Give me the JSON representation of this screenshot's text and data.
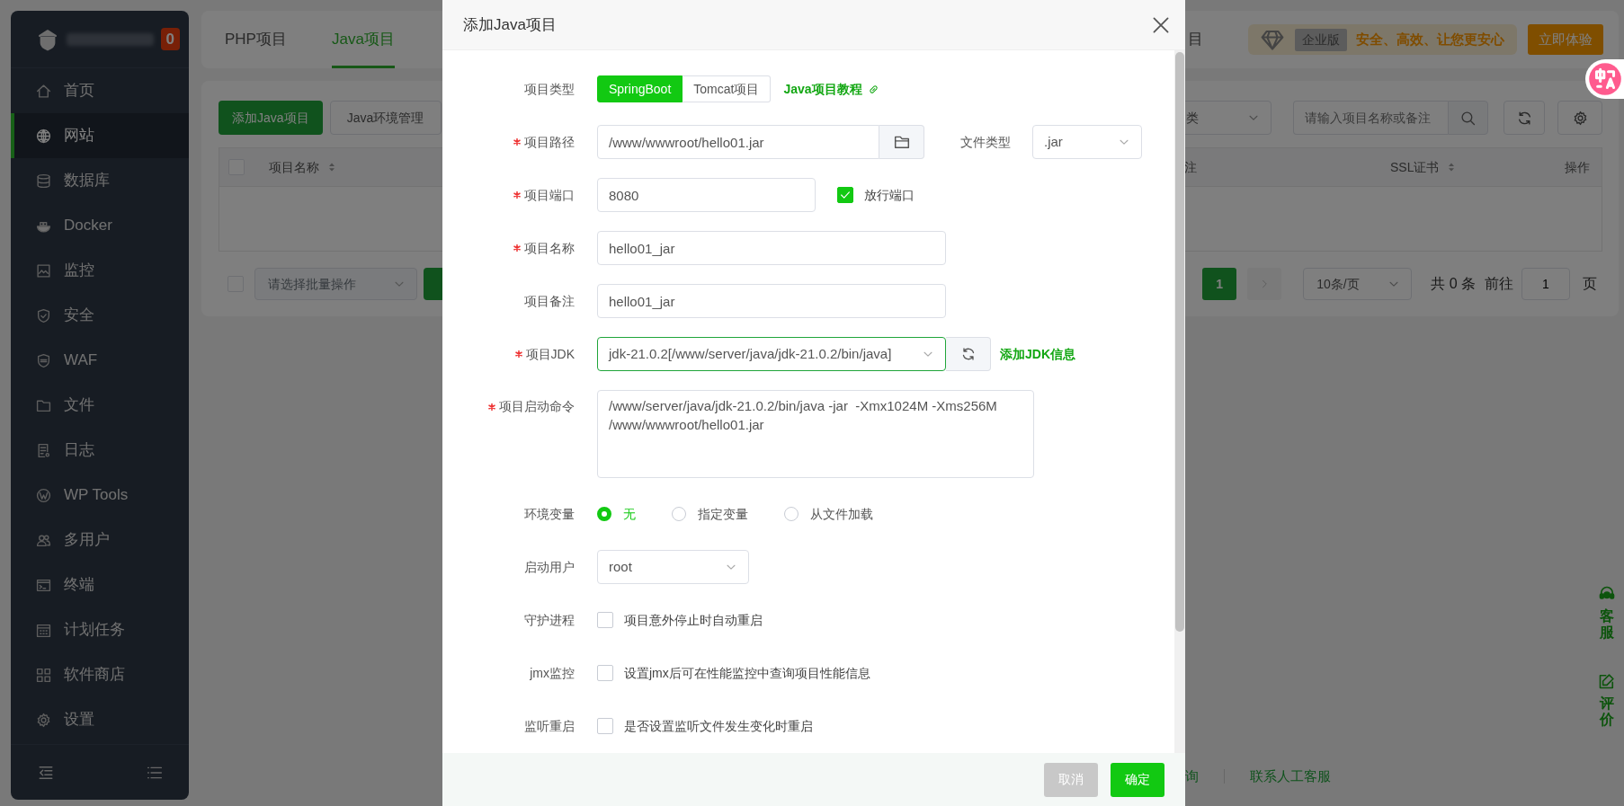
{
  "sidebar": {
    "badge": "0",
    "items": [
      {
        "label": "首页",
        "selected": false
      },
      {
        "label": "网站",
        "selected": true
      },
      {
        "label": "数据库",
        "selected": false
      },
      {
        "label": "Docker",
        "selected": false
      },
      {
        "label": "监控",
        "selected": false
      },
      {
        "label": "安全",
        "selected": false
      },
      {
        "label": "WAF",
        "selected": false
      },
      {
        "label": "文件",
        "selected": false
      },
      {
        "label": "日志",
        "selected": false
      },
      {
        "label": "WP Tools",
        "selected": false
      },
      {
        "label": "多用户",
        "selected": false
      },
      {
        "label": "终端",
        "selected": false
      },
      {
        "label": "计划任务",
        "selected": false
      },
      {
        "label": "软件商店",
        "selected": false
      },
      {
        "label": "设置",
        "selected": false
      }
    ]
  },
  "tabs": [
    {
      "label": "PHP项目",
      "selected": false
    },
    {
      "label": "Java项目",
      "selected": true
    },
    {
      "label": "目",
      "selected": false
    }
  ],
  "promo": {
    "edition": "企业版",
    "slogan": "安全、高效、让您更安心",
    "button": "立即体验"
  },
  "toolbar": {
    "buttons": [
      "添加Java项目",
      "Java环境管理"
    ],
    "category_select": "类",
    "search": {
      "placeholder": "请输入项目名称或备注"
    }
  },
  "table": {
    "select_all": {
      "checked": false
    },
    "columns": [
      {
        "label": "项目名称",
        "sortable": true
      },
      {
        "label": "注",
        "sortable": false
      },
      {
        "label": "SSL证书",
        "sortable": true
      },
      {
        "label": "操作",
        "sortable": false
      }
    ]
  },
  "batch": {
    "checked": false,
    "placeholder": "请选择批量操作"
  },
  "pagination": {
    "pages": [
      {
        "label": "1",
        "selected": true
      }
    ],
    "page_size": "10条/页",
    "total": "共 0 条",
    "goto": "前往",
    "page_input": "1",
    "page_unit": "页"
  },
  "footer_links": [
    "询",
    "联系人工客服"
  ],
  "side_widget": [
    "客服",
    "评价"
  ],
  "dialog": {
    "title": "添加Java项目",
    "fields": [
      {
        "kind": "segmented",
        "label": "项目类型",
        "required": false,
        "options": [
          {
            "label": "SpringBoot",
            "selected": true
          },
          {
            "label": "Tomcat项目",
            "selected": false
          }
        ],
        "link": "Java项目教程"
      },
      {
        "kind": "path",
        "label": "项目路径",
        "required": true,
        "value": "/www/wwwroot/hello01.jar",
        "extra_label": "文件类型",
        "extra_value": ".jar"
      },
      {
        "kind": "port",
        "label": "项目端口",
        "required": true,
        "value": "8080",
        "checkbox": {
          "label": "放行端口",
          "checked": true
        }
      },
      {
        "kind": "text",
        "label": "项目名称",
        "required": true,
        "value": "hello01_jar"
      },
      {
        "kind": "text",
        "label": "项目备注",
        "required": false,
        "value": "hello01_jar"
      },
      {
        "kind": "jdk",
        "label": "项目JDK",
        "required": true,
        "value": "jdk-21.0.2[/www/server/java/jdk-21.0.2/bin/java]",
        "link": "添加JDK信息"
      },
      {
        "kind": "textarea",
        "label": "项目启动命令",
        "required": true,
        "value": "/www/server/java/jdk-21.0.2/bin/java -jar  -Xmx1024M -Xms256M /www/wwwroot/hello01.jar"
      },
      {
        "kind": "radio",
        "label": "环境变量",
        "required": false,
        "options": [
          {
            "label": "无",
            "selected": true
          },
          {
            "label": "指定变量",
            "selected": false
          },
          {
            "label": "从文件加载",
            "selected": false
          }
        ]
      },
      {
        "kind": "select",
        "label": "启动用户",
        "required": false,
        "value": "root"
      },
      {
        "kind": "checkbox",
        "label": "守护进程",
        "required": false,
        "checkbox": {
          "label": "项目意外停止时自动重启",
          "checked": false
        }
      },
      {
        "kind": "checkbox",
        "label": "jmx监控",
        "required": false,
        "checkbox": {
          "label": "设置jmx后可在性能监控中查询项目性能信息",
          "checked": false
        }
      },
      {
        "kind": "checkbox",
        "label": "监听重启",
        "required": false,
        "checkbox": {
          "label": "是否设置监听文件发生变化时重启",
          "checked": false
        }
      }
    ],
    "buttons": [
      {
        "label": "取消",
        "kind": "secondary"
      },
      {
        "label": "确定",
        "kind": "primary"
      }
    ]
  }
}
